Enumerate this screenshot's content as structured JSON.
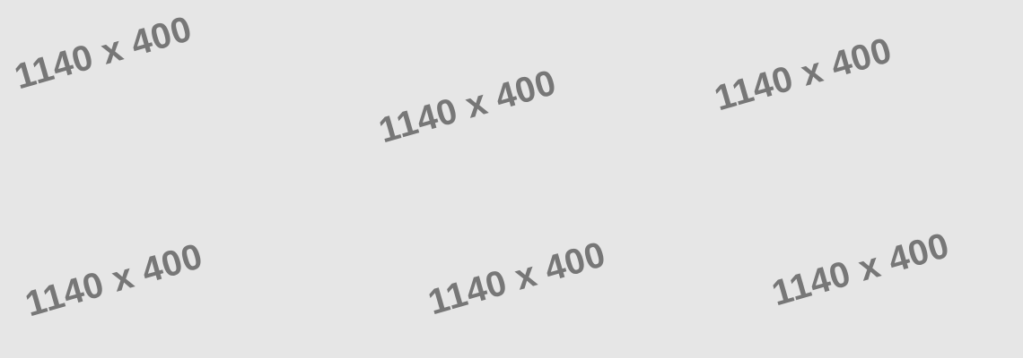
{
  "placeholder": {
    "text": "1140 x 400",
    "background_color": "#e6e6e6",
    "text_color": "#777777",
    "repetitions": 6
  }
}
